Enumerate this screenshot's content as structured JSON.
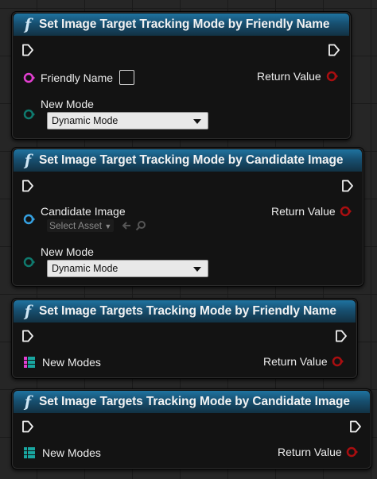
{
  "nodes": [
    {
      "title": "Set Image Target Tracking Mode by Friendly Name",
      "input_label": "Friendly Name",
      "mode_label": "New Mode",
      "mode_value": "Dynamic Mode",
      "return_label": "Return Value"
    },
    {
      "title": "Set Image Target Tracking Mode by Candidate Image",
      "input_label": "Candidate Image",
      "asset_placeholder": "Select Asset",
      "mode_label": "New Mode",
      "mode_value": "Dynamic Mode",
      "return_label": "Return Value"
    },
    {
      "title": "Set Image Targets Tracking Mode by Friendly Name",
      "input_label": "New Modes",
      "return_label": "Return Value"
    },
    {
      "title": "Set Image Targets Tracking Mode by Candidate Image",
      "input_label": "New Modes",
      "return_label": "Return Value"
    }
  ],
  "icons": {
    "function": "f",
    "exec_pin": "exec-arrow-icon",
    "string_pin": "magenta-pin-icon",
    "object_pin": "blue-pin-icon",
    "enum_pin": "teal-pin-icon",
    "array_pin": "grid-array-icon",
    "return_pin": "red-pin-icon"
  },
  "colors": {
    "header": "#1f73a0",
    "string_pin": "#e23fd0",
    "object_pin": "#35a0e0",
    "enum_pin": "#0f7a6e",
    "array_pin_a": "#e23fd0",
    "array_pin_b": "#19a6a0",
    "return_pin": "#a90e10"
  }
}
